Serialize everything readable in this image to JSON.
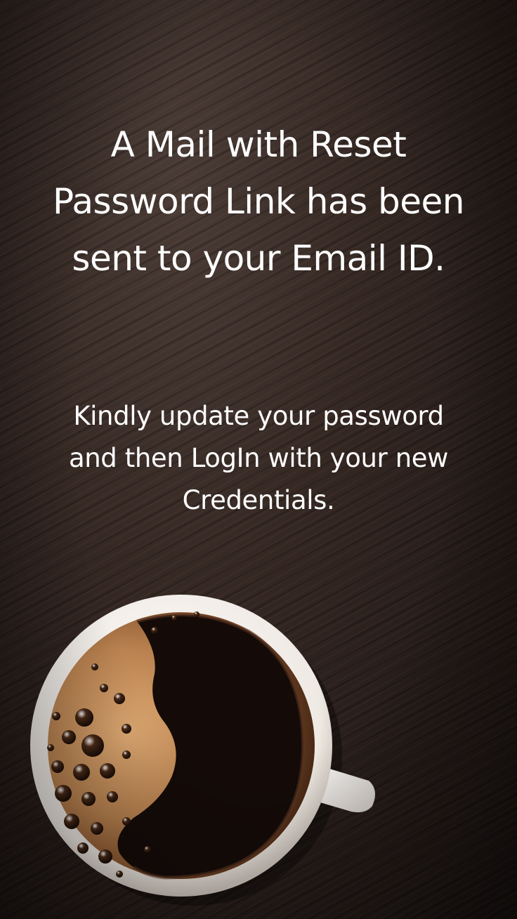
{
  "message": {
    "headline": "A Mail with Reset Password Link has been sent to your Email ID.",
    "subtext": "Kindly update your password and then LogIn with your new Credentials."
  },
  "background": {
    "image": "coffee-cup-on-wooden-table",
    "colors": {
      "wood": "#2e2320",
      "crema": "#b8814f",
      "coffee": "#120b09",
      "cup": "#f4f1ee"
    }
  }
}
